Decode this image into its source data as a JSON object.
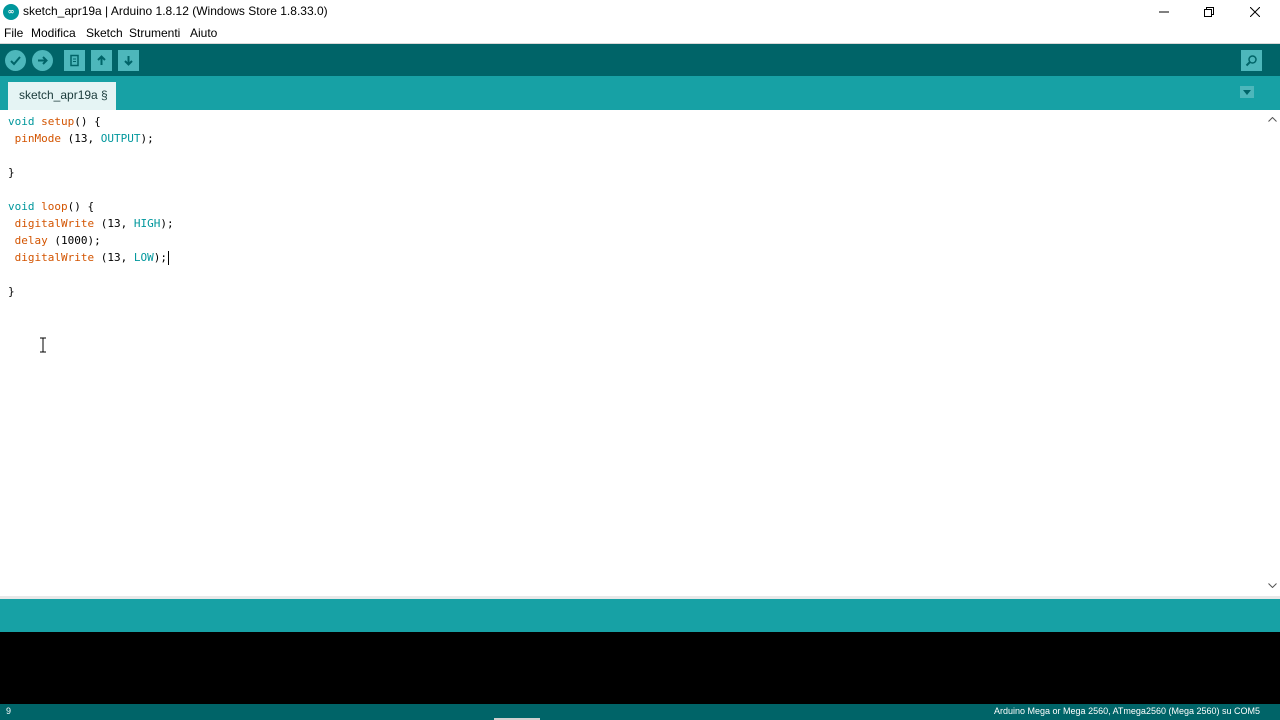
{
  "window": {
    "title": "sketch_apr19a | Arduino 1.8.12 (Windows Store 1.8.33.0)",
    "icon": "arduino-logo-icon",
    "icon_text": "∞",
    "controls": [
      "minimize-icon",
      "maximize-icon",
      "close-icon"
    ]
  },
  "menu": {
    "items": [
      "File",
      "Modifica",
      "Sketch",
      "Strumenti",
      "Aiuto"
    ]
  },
  "toolbar": {
    "buttons": [
      "verify-icon",
      "upload-icon",
      "new-icon",
      "open-icon",
      "save-icon"
    ],
    "right_button": "serial-monitor-icon"
  },
  "tabs": [
    {
      "label": "sketch_apr19a §",
      "active": true
    }
  ],
  "tab_menu_icon": "tab-dropdown-icon",
  "editor": {
    "lines": [
      "void setup() {",
      " pinMode (13, OUTPUT);",
      "",
      "}",
      "",
      "void loop() {",
      " digitalWrite (13, HIGH);",
      " delay (1000);",
      " digitalWrite (13, LOW);",
      "",
      "}"
    ]
  },
  "status": {
    "line_number": "9",
    "board": "Arduino Mega or Mega 2560, ATmega2560 (Mega 2560) su COM5"
  },
  "colors": {
    "toolbar": "#006468",
    "tabstrip": "#17a1a5",
    "button": "#4db7bb",
    "keyword": "#00979c",
    "function": "#d35400",
    "console": "#000000"
  }
}
